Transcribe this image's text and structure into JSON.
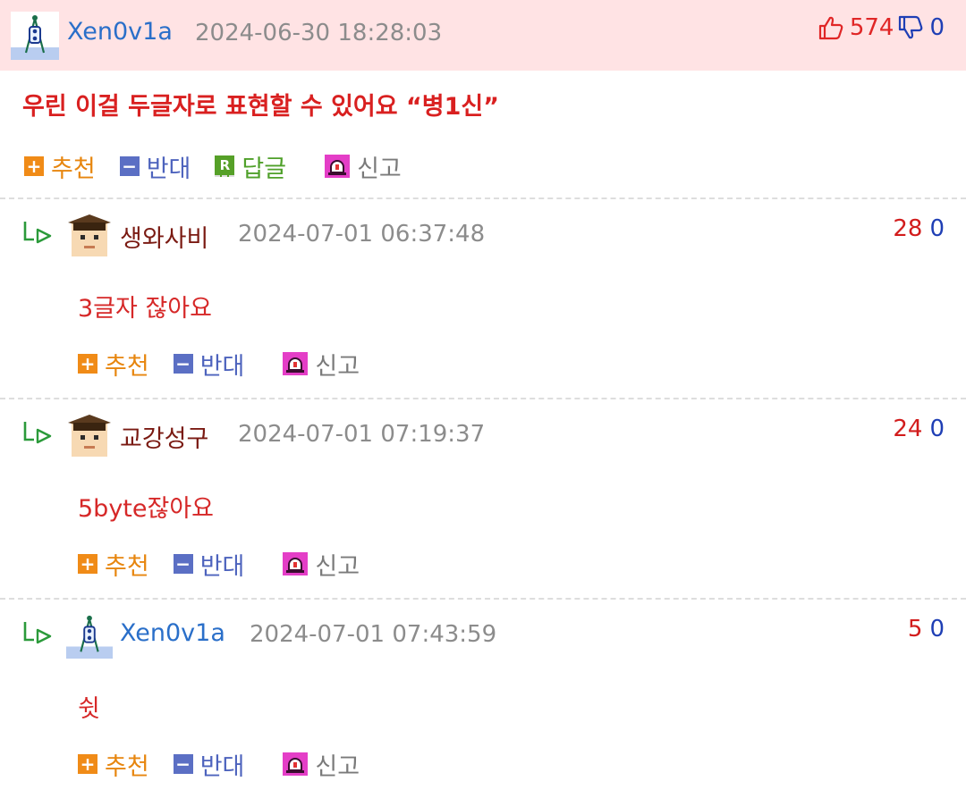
{
  "main_comment": {
    "nickname": "Xen0v1a",
    "date": "2024-06-30 18:28:03",
    "upvotes": "574",
    "downvotes": "0",
    "text": "우린 이걸 두글자로 표현할 수 있어요 “병1신”",
    "actions": {
      "up": "추천",
      "down": "반대",
      "reply": "답글",
      "report": "신고"
    }
  },
  "replies": [
    {
      "nickname": "생와사비",
      "date": "2024-07-01 06:37:48",
      "upvotes": "28",
      "downvotes": "0",
      "text": "3글자 잖아요",
      "avatar": "graduate-avatar"
    },
    {
      "nickname": "교강성구",
      "date": "2024-07-01 07:19:37",
      "upvotes": "24",
      "downvotes": "0",
      "text": "5byte잖아요",
      "avatar": "graduate-avatar"
    },
    {
      "nickname": "Xen0v1a",
      "date": "2024-07-01 07:43:59",
      "upvotes": "5",
      "downvotes": "0",
      "text": "쉿",
      "avatar": "robot-avatar"
    }
  ],
  "reply_actions": {
    "up": "추천",
    "down": "반대",
    "report": "신고"
  },
  "icons": {
    "upvote": "thumbs-up-icon",
    "downvote": "thumbs-down-icon",
    "plus": "plus-icon",
    "minus": "minus-icon",
    "reply": "reply-icon",
    "report": "siren-icon",
    "reply_arrow": "reply-arrow-icon"
  },
  "colors": {
    "header_bg": "#ffe3e4",
    "nick_blue": "#2a6fc9",
    "red_text": "#d92020",
    "up_orange": "#f08b17",
    "down_blue": "#5b6fc4",
    "reply_green": "#56a028",
    "report_pink": "#e43ec7"
  }
}
